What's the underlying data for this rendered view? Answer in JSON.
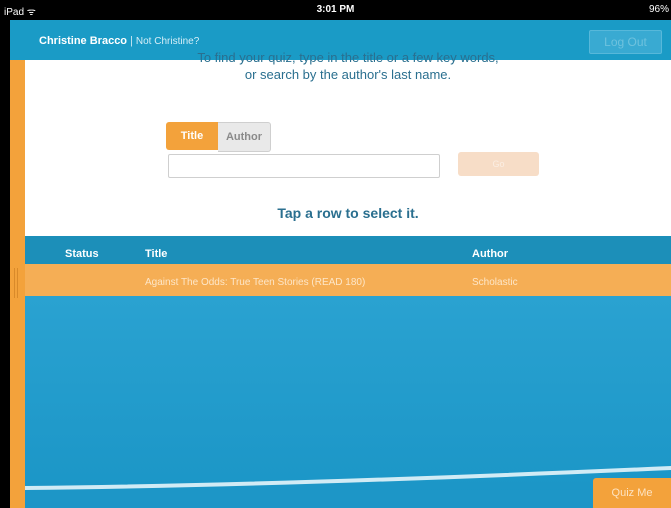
{
  "status_bar": {
    "device": "iPad ᯤ",
    "time": "3:01 PM",
    "battery": "96%"
  },
  "header": {
    "user_name": "Christine Bracco",
    "separator": "|",
    "not_user_link": "Not Christine?",
    "logout_label": "Log Out"
  },
  "search": {
    "instructions_line1": "To find your quiz, type in the title or a few key words,",
    "instructions_line2": "or search by the author's last name.",
    "segments": [
      "Title",
      "Author"
    ],
    "selected_segment": "Title",
    "input_value": "",
    "go_label": "Go",
    "tap_hint": "Tap a row to select it."
  },
  "table": {
    "columns": [
      "Status",
      "Title",
      "Author"
    ],
    "rows": [
      {
        "status": "",
        "title": "Against The Odds: True Teen Stories (READ 180)",
        "author": "Scholastic"
      }
    ]
  },
  "footer": {
    "quiz_button": "Quiz Me"
  },
  "colors": {
    "header_blue": "#1a9bc6",
    "accent_orange": "#f3a23b",
    "row_highlight": "#f5ae55"
  }
}
